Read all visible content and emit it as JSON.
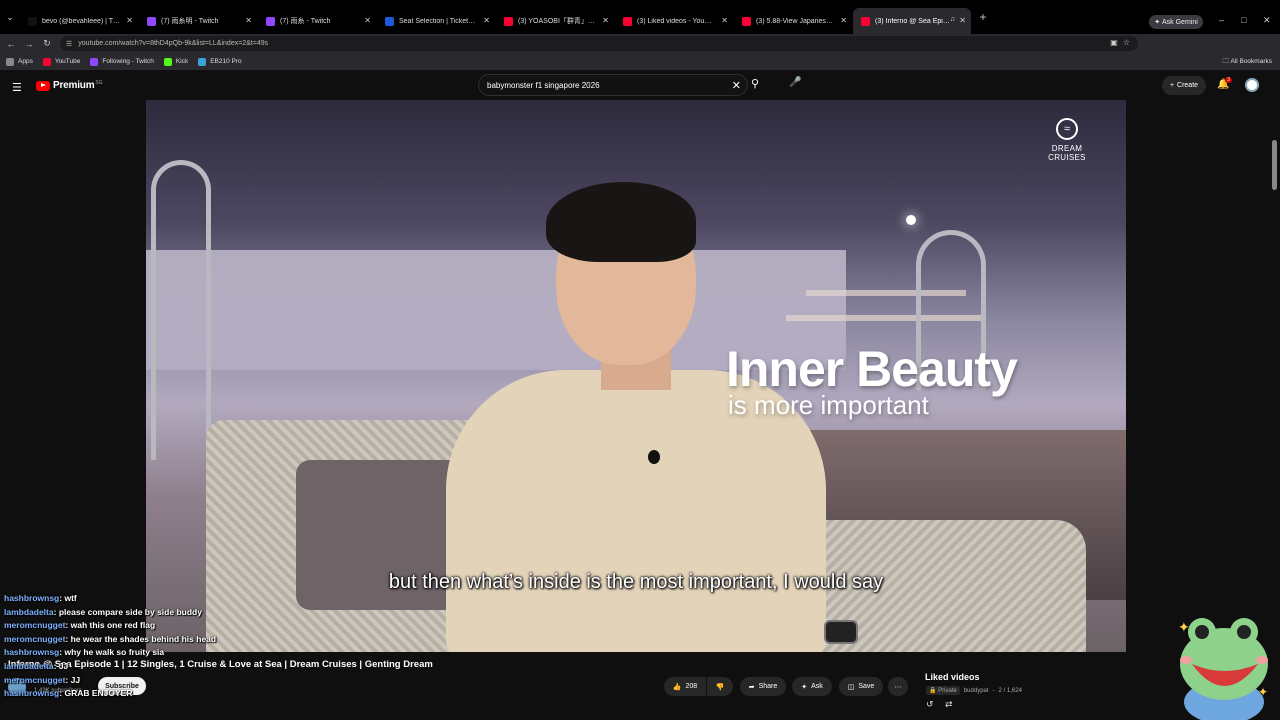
{
  "browser": {
    "tabs": [
      {
        "title": "bevo (@bevahleee) | TikTok",
        "color": "#111111",
        "active": false
      },
      {
        "title": "(7) 雨糸明 - Twitch",
        "color": "#9146ff",
        "active": false
      },
      {
        "title": "(7) 雨糸 - Twitch",
        "color": "#9146ff",
        "active": false
      },
      {
        "title": "Seat Selection | Ticketmaster SG",
        "color": "#1e5bd8",
        "active": false
      },
      {
        "title": "(3) YOASOBI「群青」(Blue) from",
        "color": "#ff0033",
        "active": false
      },
      {
        "title": "(3) Liked videos - YouTube",
        "color": "#ff0033",
        "active": false
      },
      {
        "title": "(3) 5.88-View Japanese Singer",
        "color": "#ff0033",
        "active": false
      },
      {
        "title": "(3) Inferno @ Sea Episode",
        "color": "#ff0033",
        "active": true
      }
    ],
    "ask_gemini": "Ask Gemini",
    "url": "youtube.com/watch?v=8thD4pQb-9k&list=LL&index=2&t=49s",
    "bookmarks": [
      {
        "label": "Apps",
        "color": "#888888"
      },
      {
        "label": "YouTube",
        "color": "#ff0033"
      },
      {
        "label": "Following - Twitch",
        "color": "#9146ff"
      },
      {
        "label": "Kick",
        "color": "#53fc18"
      },
      {
        "label": "EB210 Pro",
        "color": "#3aa0d8"
      }
    ],
    "all_bookmarks": "All Bookmarks"
  },
  "youtube": {
    "logo_text": "Premium",
    "logo_sup": "SG",
    "search_query": "babymonster f1 singapore 2026",
    "create_label": "Create",
    "notification_count": "3"
  },
  "video": {
    "brand": "DREAM CRUISES",
    "overlay_title": "Inner Beauty",
    "overlay_subtitle": "is more important",
    "caption": "but then what’s inside is the most important, I would say",
    "title": "Inferno @ Sea Episode 1 | 12 Singles, 1 Cruise & Love at Sea | Dream Cruises | Genting Dream",
    "channel_subs": "1.43K subscribers",
    "subscribe_label": "Subscribe",
    "like_count": "208",
    "share_label": "Share",
    "ask_label": "Ask",
    "save_label": "Save"
  },
  "playlist": {
    "title": "Liked videos",
    "privacy": "Private",
    "owner": "buddypat",
    "position": "2 / 1,624"
  },
  "chat": [
    {
      "user": "hashbrownsg",
      "message": "wtf"
    },
    {
      "user": "lambdadelta",
      "message": "please compare side by side buddy"
    },
    {
      "user": "meromcnugget",
      "message": "wah this one red flag"
    },
    {
      "user": "meromcnugget",
      "message": "he wear the shades behind his head"
    },
    {
      "user": "hashbrownsg",
      "message": "why he walk so fruity sia"
    },
    {
      "user": "lambdadelta",
      "message": "JJ"
    },
    {
      "user": "meromcnugget",
      "message": "JJ"
    },
    {
      "user": "hashbrownsg",
      "message": "GRAB ENJOYER"
    }
  ]
}
